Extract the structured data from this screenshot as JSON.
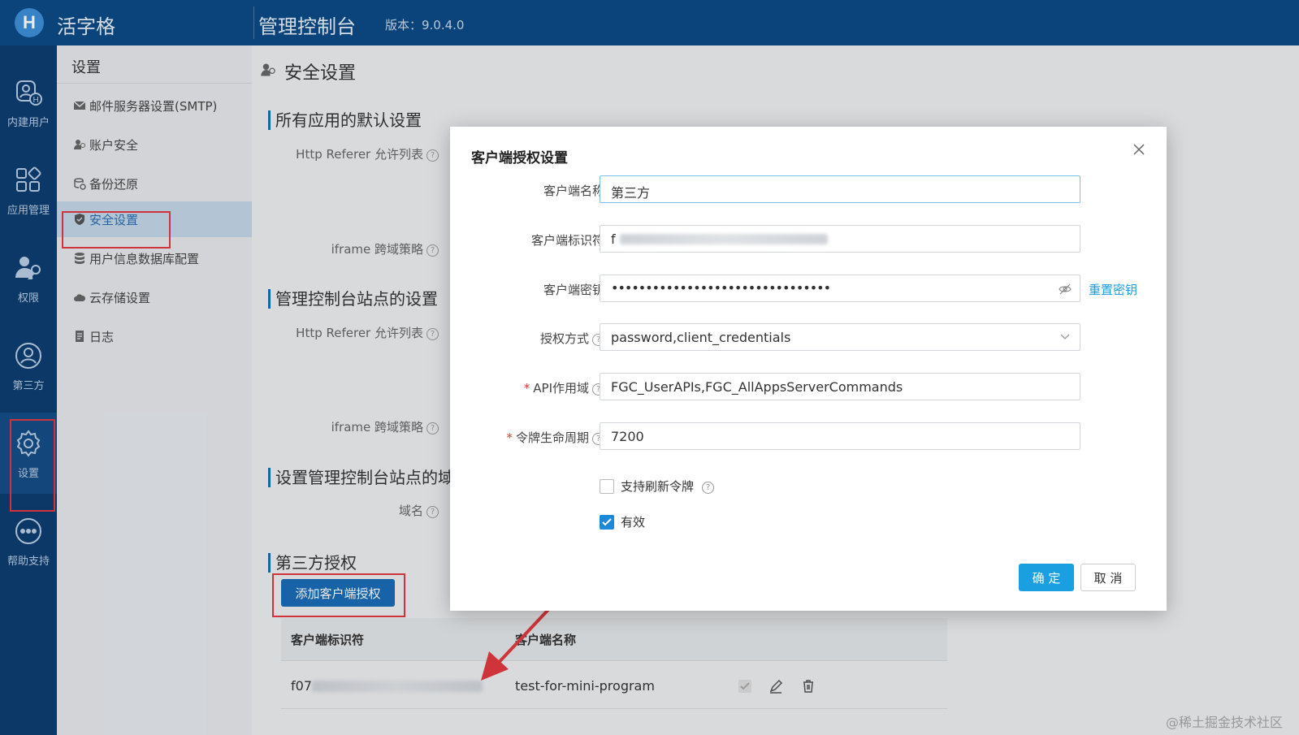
{
  "topbar": {
    "logo_letter": "H",
    "brand": "活字格",
    "title": "管理控制台",
    "version": "版本：9.0.4.0"
  },
  "leftnav": {
    "items": [
      {
        "label": "内建用户",
        "icon": "user-h-icon"
      },
      {
        "label": "应用管理",
        "icon": "apps-grid-icon"
      },
      {
        "label": "权限",
        "icon": "user-key-icon"
      },
      {
        "label": "第三方",
        "icon": "third-party-icon"
      },
      {
        "label": "设置",
        "icon": "gear-icon",
        "active": true
      },
      {
        "label": "帮助支持",
        "icon": "more-dots-icon"
      }
    ]
  },
  "submenu": {
    "title": "设置",
    "items": [
      {
        "label": "邮件服务器设置(SMTP)",
        "icon": "mail-icon"
      },
      {
        "label": "账户安全",
        "icon": "user-key-icon"
      },
      {
        "label": "备份还原",
        "icon": "backup-icon"
      },
      {
        "label": "安全设置",
        "icon": "shield-icon",
        "active": true
      },
      {
        "label": "用户信息数据库配置",
        "icon": "database-icon"
      },
      {
        "label": "云存储设置",
        "icon": "cloud-icon"
      },
      {
        "label": "日志",
        "icon": "log-icon"
      }
    ]
  },
  "content": {
    "page_title": "安全设置",
    "sections": [
      {
        "title": "所有应用的默认设置"
      },
      {
        "title": "管理控制台站点的设置"
      },
      {
        "title": "设置管理控制台站点的域"
      },
      {
        "title": "第三方授权"
      }
    ],
    "labels": {
      "referer1": "Http Referer 允许列表",
      "iframe1": "iframe 跨域策略",
      "referer2": "Http Referer 允许列表",
      "iframe2": "iframe 跨域策略",
      "domain": "域名"
    },
    "add_button": "添加客户端授权",
    "table": {
      "headers": [
        "客户端标识符",
        "客户端名称"
      ],
      "rows": [
        {
          "id_prefix": "f07",
          "name": "test-for-mini-program"
        }
      ]
    }
  },
  "modal": {
    "title": "客户端授权设置",
    "fields": {
      "client_name_label": "客户端名称",
      "client_name_value": "第三方",
      "client_id_label": "客户端标识符",
      "client_id_prefix": "f",
      "client_secret_label": "客户端密钥",
      "client_secret_mask": "••••••••••••••••••••••••••••••••",
      "reset_secret": "重置密钥",
      "grant_label": "授权方式",
      "grant_value": "password,client_credentials",
      "scope_label": "API作用域",
      "scope_value": "FGC_UserAPIs,FGC_AllAppsServerCommands",
      "token_label": "令牌生命周期",
      "token_value": "7200",
      "refresh_label": "支持刷新令牌",
      "valid_label": "有效"
    },
    "required_mark": "*",
    "ok": "确 定",
    "cancel": "取 消"
  },
  "watermark": "@稀土掘金技术社区",
  "colors": {
    "topbar": "#0b4a86",
    "accent": "#1aa0e0",
    "highlight": "#e0393e"
  }
}
